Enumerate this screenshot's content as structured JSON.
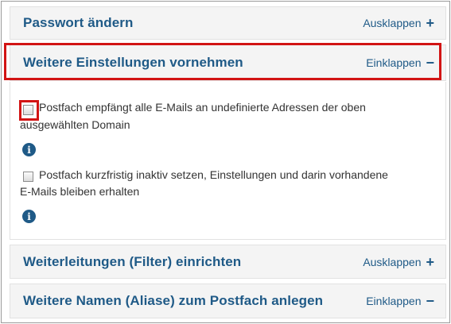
{
  "sections": [
    {
      "title": "Passwort ändern",
      "toggle_label": "Ausklappen",
      "toggle_icon": "+"
    },
    {
      "title": "Weitere Einstellungen vornehmen",
      "toggle_label": "Einklappen",
      "toggle_icon": "−"
    },
    {
      "title": "Weiterleitungen (Filter) einrichten",
      "toggle_label": "Ausklappen",
      "toggle_icon": "+"
    },
    {
      "title": "Weitere Namen (Aliase) zum Postfach anlegen",
      "toggle_label": "Einklappen",
      "toggle_icon": "−"
    }
  ],
  "options": [
    {
      "line1": "Postfach empfängt alle E-Mails an undefinierte Adressen der oben",
      "line2": "ausgewählten Domain",
      "checked": false
    },
    {
      "line1": "Postfach kurzfristig inaktiv setzen, Einstellungen und darin vorhandene",
      "line2": "E-Mails bleiben erhalten",
      "checked": false
    }
  ],
  "info_icon": "i",
  "colors": {
    "accent": "#1f5a87",
    "highlight": "#d21414"
  }
}
